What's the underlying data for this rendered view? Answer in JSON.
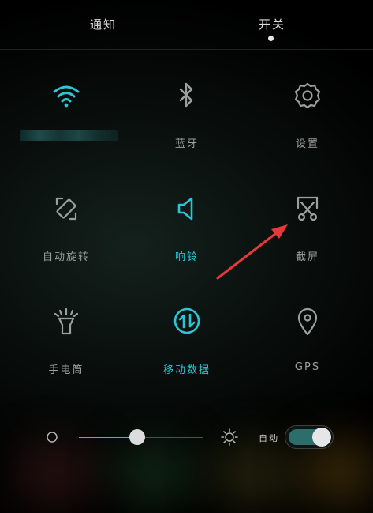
{
  "tabs": [
    {
      "label": "通知",
      "selected": false
    },
    {
      "label": "开关",
      "selected": true
    }
  ],
  "toggles": [
    {
      "label": "",
      "icon": "wifi-icon",
      "active": true
    },
    {
      "label": "蓝牙",
      "icon": "bluetooth-icon",
      "active": false
    },
    {
      "label": "设置",
      "icon": "gear-icon",
      "active": false
    },
    {
      "label": "自动旋转",
      "icon": "rotate-icon",
      "active": false
    },
    {
      "label": "响铃",
      "icon": "speaker-icon",
      "active": true
    },
    {
      "label": "截屏",
      "icon": "screenshot-icon",
      "active": false
    },
    {
      "label": "手电筒",
      "icon": "flashlight-icon",
      "active": false
    },
    {
      "label": "移动数据",
      "icon": "mobile-data-icon",
      "active": true
    },
    {
      "label": "GPS",
      "icon": "location-pin-icon",
      "active": false
    }
  ],
  "brightness": {
    "level": 0.47,
    "auto_label": "自动",
    "auto_enabled": true
  },
  "colors": {
    "accent": "#29c6d6",
    "inactive": "#9aa09e",
    "annotation_arrow": "#e8393a"
  }
}
